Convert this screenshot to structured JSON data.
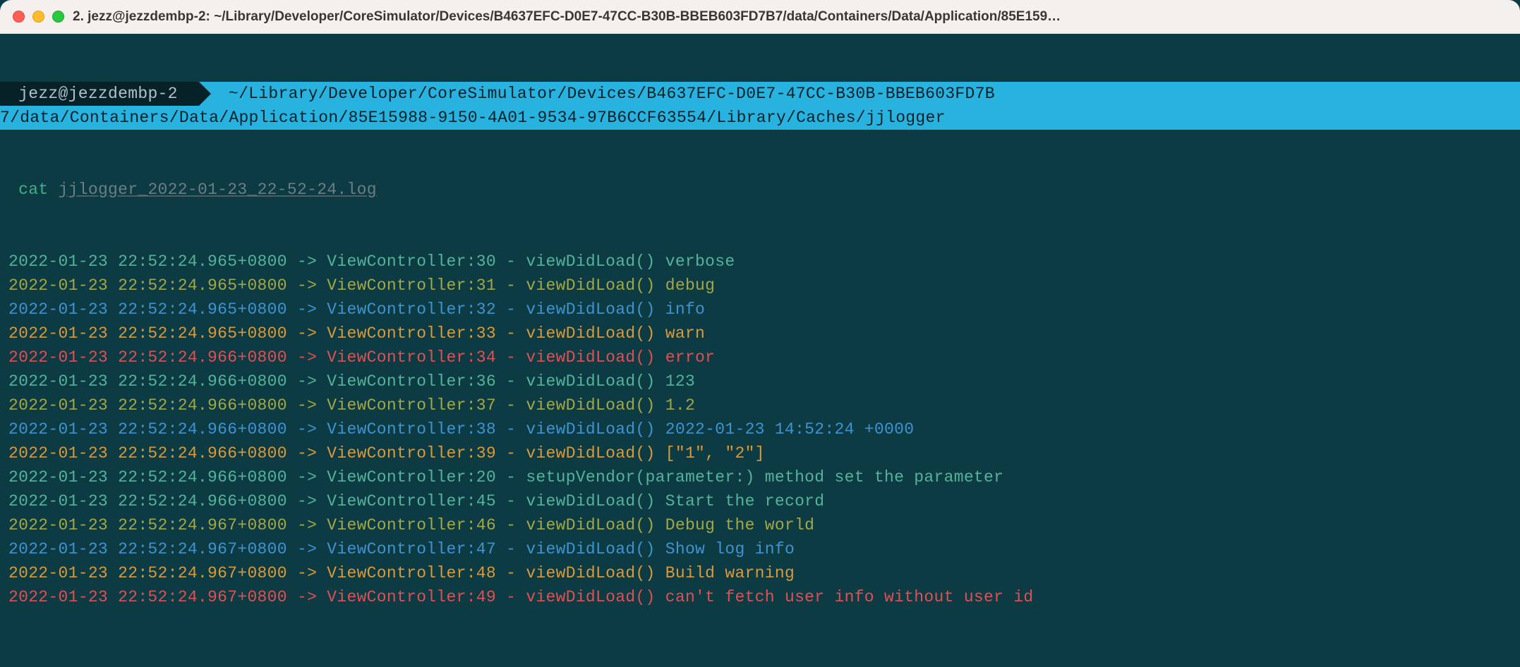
{
  "window": {
    "title": "2. jezz@jezzdembp-2: ~/Library/Developer/CoreSimulator/Devices/B4637EFC-D0E7-47CC-B30B-BBEB603FD7B7/data/Containers/Data/Application/85E159…"
  },
  "prompt": {
    "user": " jezz@jezzdembp-2 ",
    "path1": " ~/Library/Developer/CoreSimulator/Devices/B4637EFC-D0E7-47CC-B30B-BBEB603FD7B",
    "path2": "7/data/Containers/Data/Application/85E15988-9150-4A01-9534-97B6CCF63554/Library/Caches/jjlogger "
  },
  "command": {
    "name": " cat",
    "arg": "jjlogger_2022-01-23_22-52-24.log"
  },
  "logs": [
    {
      "color": "teal",
      "text": "2022-01-23 22:52:24.965+0800 -> ViewController:30 - viewDidLoad() verbose"
    },
    {
      "color": "olive",
      "text": "2022-01-23 22:52:24.965+0800 -> ViewController:31 - viewDidLoad() debug"
    },
    {
      "color": "blue",
      "text": "2022-01-23 22:52:24.965+0800 -> ViewController:32 - viewDidLoad() info"
    },
    {
      "color": "orange",
      "text": "2022-01-23 22:52:24.965+0800 -> ViewController:33 - viewDidLoad() warn"
    },
    {
      "color": "red",
      "text": "2022-01-23 22:52:24.966+0800 -> ViewController:34 - viewDidLoad() error"
    },
    {
      "color": "teal",
      "text": "2022-01-23 22:52:24.966+0800 -> ViewController:36 - viewDidLoad() 123"
    },
    {
      "color": "olive",
      "text": "2022-01-23 22:52:24.966+0800 -> ViewController:37 - viewDidLoad() 1.2"
    },
    {
      "color": "blue",
      "text": "2022-01-23 22:52:24.966+0800 -> ViewController:38 - viewDidLoad() 2022-01-23 14:52:24 +0000"
    },
    {
      "color": "orange",
      "text": "2022-01-23 22:52:24.966+0800 -> ViewController:39 - viewDidLoad() [\"1\", \"2\"]"
    },
    {
      "color": "teal",
      "text": "2022-01-23 22:52:24.966+0800 -> ViewController:20 - setupVendor(parameter:) method set the parameter"
    },
    {
      "color": "teal",
      "text": "2022-01-23 22:52:24.966+0800 -> ViewController:45 - viewDidLoad() Start the record"
    },
    {
      "color": "olive",
      "text": "2022-01-23 22:52:24.967+0800 -> ViewController:46 - viewDidLoad() Debug the world"
    },
    {
      "color": "blue",
      "text": "2022-01-23 22:52:24.967+0800 -> ViewController:47 - viewDidLoad() Show log info"
    },
    {
      "color": "orange",
      "text": "2022-01-23 22:52:24.967+0800 -> ViewController:48 - viewDidLoad() Build warning"
    },
    {
      "color": "red",
      "text": "2022-01-23 22:52:24.967+0800 -> ViewController:49 - viewDidLoad() can't fetch user info without user id"
    }
  ]
}
